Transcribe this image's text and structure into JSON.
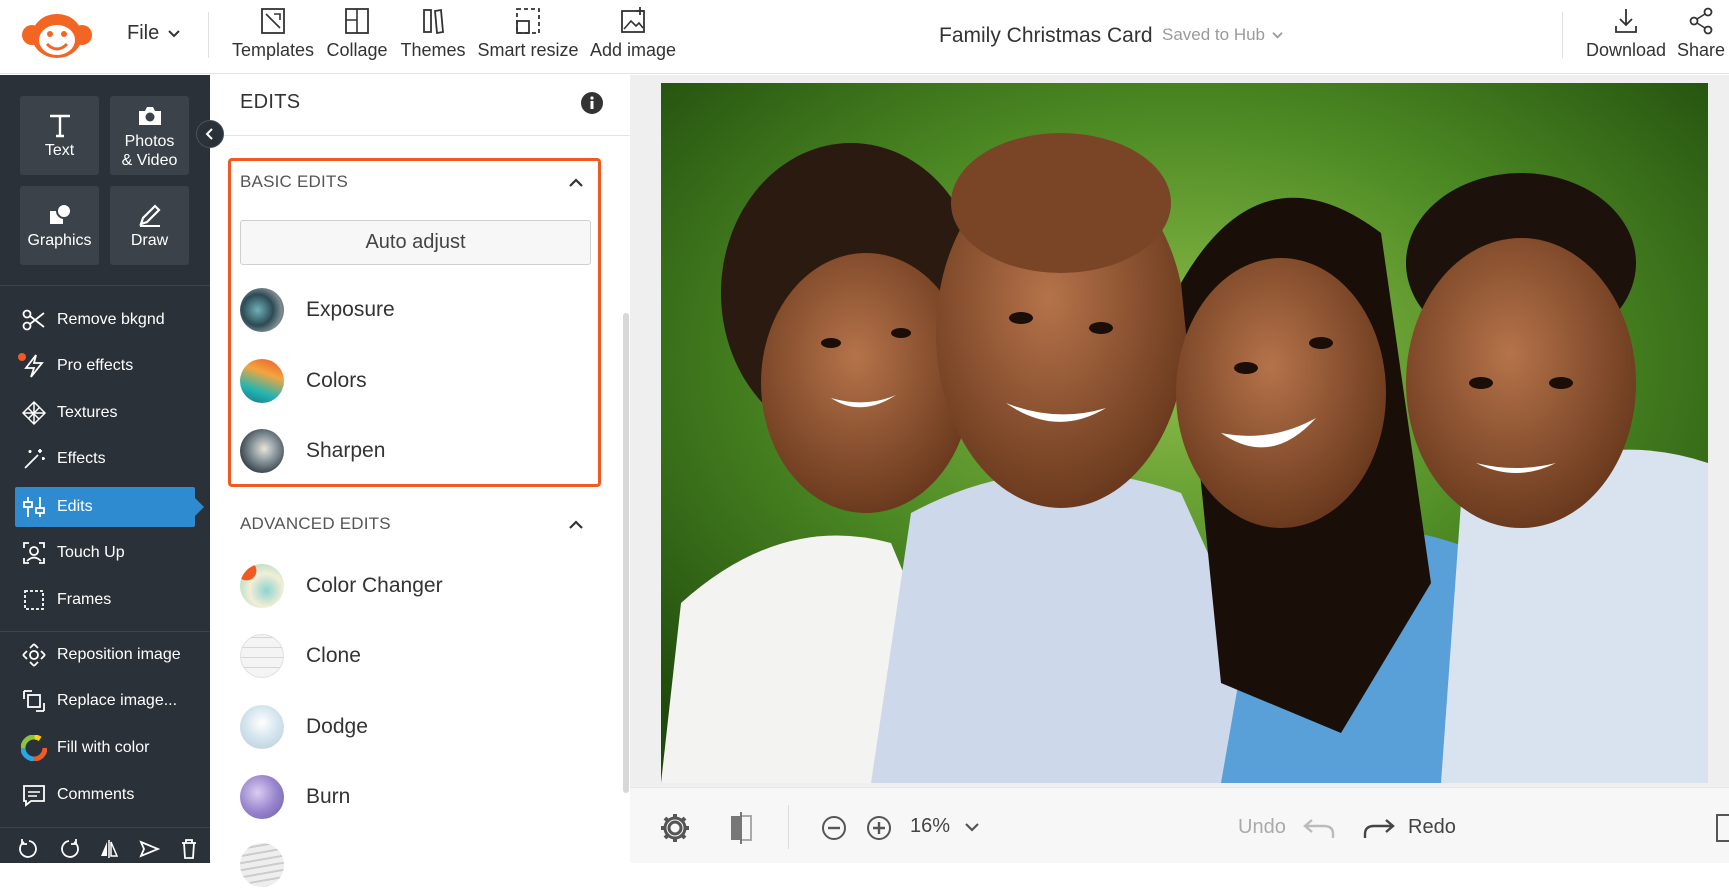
{
  "topbar": {
    "file_label": "File",
    "tools": [
      {
        "label": "Templates",
        "icon": "templates-icon"
      },
      {
        "label": "Collage",
        "icon": "collage-icon"
      },
      {
        "label": "Themes",
        "icon": "themes-icon"
      },
      {
        "label": "Smart resize",
        "icon": "smart-resize-icon"
      },
      {
        "label": "Add image",
        "icon": "add-image-icon"
      }
    ],
    "doc_title": "Family Christmas Card",
    "saved_status": "Saved to Hub",
    "download_label": "Download",
    "share_label": "Share"
  },
  "sidebar": {
    "big_buttons": [
      "Text",
      "Photos\n& Video",
      "Graphics",
      "Draw"
    ],
    "items": [
      {
        "label": "Remove bkgnd",
        "icon": "scissors-icon"
      },
      {
        "label": "Pro effects",
        "icon": "lightning-icon"
      },
      {
        "label": "Textures",
        "icon": "textures-icon"
      },
      {
        "label": "Effects",
        "icon": "magic-wand-icon"
      },
      {
        "label": "Edits",
        "icon": "sliders-icon"
      },
      {
        "label": "Touch Up",
        "icon": "face-icon"
      },
      {
        "label": "Frames",
        "icon": "frame-icon"
      },
      {
        "label": "Reposition image",
        "icon": "reposition-icon"
      },
      {
        "label": "Replace image...",
        "icon": "replace-icon"
      },
      {
        "label": "Fill with color",
        "icon": "color-wheel-icon"
      },
      {
        "label": "Comments",
        "icon": "comment-icon"
      }
    ]
  },
  "panel": {
    "header": "EDITS",
    "basic_title": "BASIC EDITS",
    "auto_adjust": "Auto adjust",
    "basic_items": [
      "Exposure",
      "Colors",
      "Sharpen"
    ],
    "advanced_title": "ADVANCED EDITS",
    "advanced_items": [
      "Color Changer",
      "Clone",
      "Dodge",
      "Burn"
    ]
  },
  "bottombar": {
    "zoom": "16%",
    "undo": "Undo",
    "redo": "Redo"
  },
  "colors": {
    "accent": "#2e8bd0",
    "highlight": "#f05a22",
    "sidebar_bg": "#2b3138",
    "logo_orange": "#f26522"
  }
}
